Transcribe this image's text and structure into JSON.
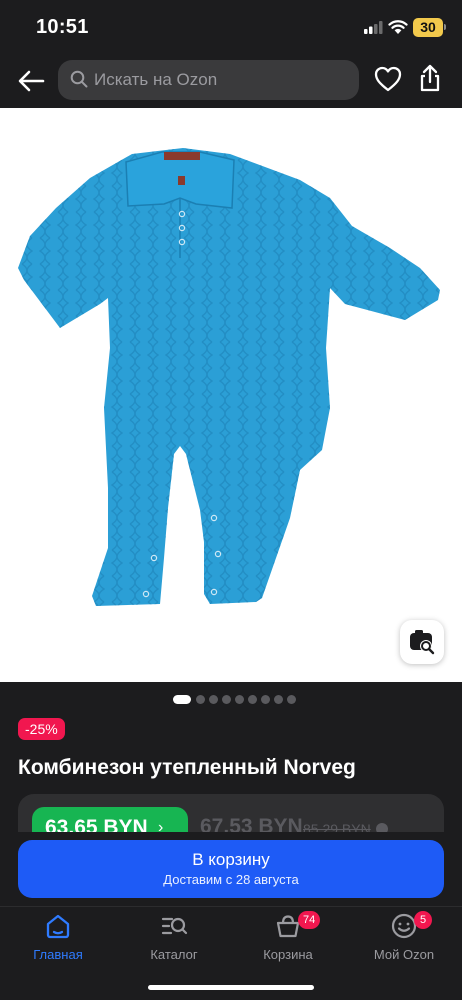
{
  "status_bar": {
    "time": "10:51",
    "battery": "30"
  },
  "search": {
    "placeholder": "Искать на Ozon"
  },
  "product": {
    "image_dots_count": 9,
    "image_dots_active": 1,
    "discount": "-25%",
    "title": "Комбинезон утепленный Norveg"
  },
  "price": {
    "card_price": "63,65 BYN",
    "regular_price": "67,53 BYN",
    "old_price": "85,29 BYN"
  },
  "cart_button": {
    "label": "В корзину",
    "delivery": "Доставим с 28 августа"
  },
  "nav": {
    "items": [
      {
        "label": "Главная",
        "icon": "home-icon",
        "active": true
      },
      {
        "label": "Каталог",
        "icon": "catalog-search-icon",
        "active": false
      },
      {
        "label": "Корзина",
        "icon": "cart-icon",
        "active": false,
        "badge": "74"
      },
      {
        "label": "Мой Ozon",
        "icon": "profile-smile-icon",
        "active": false,
        "badge": "5"
      }
    ]
  },
  "colors": {
    "background": "#1c1c1e",
    "accent_blue": "#1e5bf6",
    "discount_red": "#f1174f",
    "price_green": "#17b552",
    "product_blue": "#2b9fd6"
  }
}
